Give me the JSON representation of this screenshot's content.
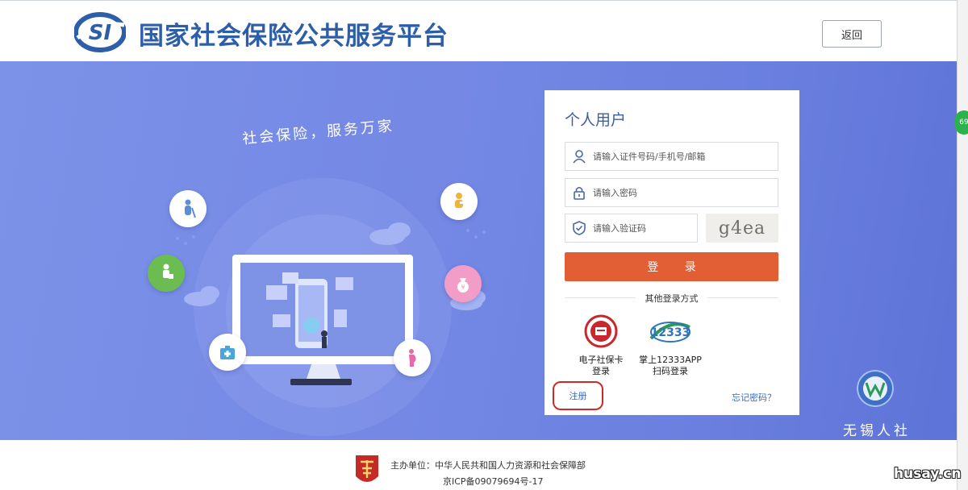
{
  "header": {
    "logo_text": "SI",
    "title": "国家社会保险公共服务平台",
    "back_label": "返回"
  },
  "banner": {
    "slogan": "社会保险，服务万家",
    "side_badge": "69"
  },
  "login": {
    "title": "个人用户",
    "username_placeholder": "请输入证件号码/手机号/邮箱",
    "password_placeholder": "请输入密码",
    "captcha_placeholder": "请输入验证码",
    "captcha_text": "g4ea",
    "submit_label": "登 录",
    "other_methods": "其他登录方式",
    "alt_methods": [
      {
        "line1": "电子社保卡",
        "line2": "登录"
      },
      {
        "line1": "掌上12333APP",
        "line2": "扫码登录"
      }
    ],
    "app_badge_text": "12333",
    "register_label": "注册",
    "forgot_label": "忘记密码？"
  },
  "brand": {
    "org_text": "无锡人社"
  },
  "footer": {
    "sponsor": "主办单位：中华人民共和国人力资源和社会保障部",
    "icp": "京ICP备09079694号-17"
  },
  "watermark": "husay.cn",
  "colors": {
    "primary_blue": "#2d5ea8",
    "banner_bg": "#7488e4",
    "login_button": "#e25e35",
    "register_highlight": "#cc2a2a",
    "link_blue": "#3b6cc4"
  }
}
